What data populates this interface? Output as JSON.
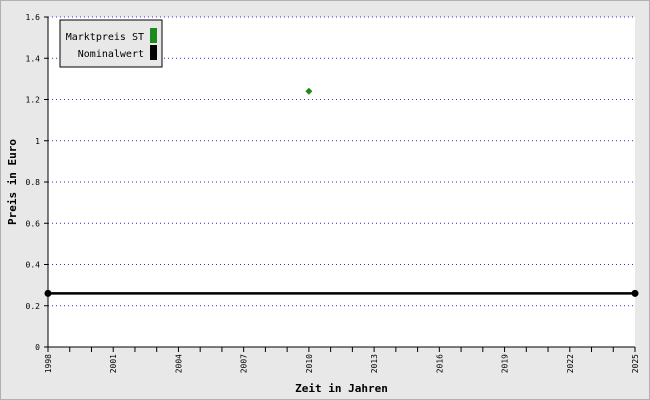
{
  "chart_data": {
    "type": "line",
    "xlabel": "Zeit in Jahren",
    "ylabel": "Preis in Euro",
    "xlim": [
      1998,
      2025
    ],
    "ylim": [
      0,
      1.6
    ],
    "x_ticks": [
      1998,
      2001,
      2004,
      2007,
      2010,
      2013,
      2016,
      2019,
      2022,
      2025
    ],
    "y_ticks": [
      0,
      0.2,
      0.4,
      0.6,
      0.8,
      1,
      1.2,
      1.4,
      1.6
    ],
    "grid": true,
    "legend_position": "top-left",
    "series": [
      {
        "name": "Marktpreis ST",
        "color": "#1a8a1a",
        "mode": "markers",
        "points": [
          {
            "x": 2010,
            "y": 1.24
          }
        ]
      },
      {
        "name": "Nominalwert",
        "color": "#000000",
        "mode": "line",
        "points": [
          {
            "x": 1998,
            "y": 0.26
          },
          {
            "x": 2025,
            "y": 0.26
          }
        ]
      }
    ]
  }
}
